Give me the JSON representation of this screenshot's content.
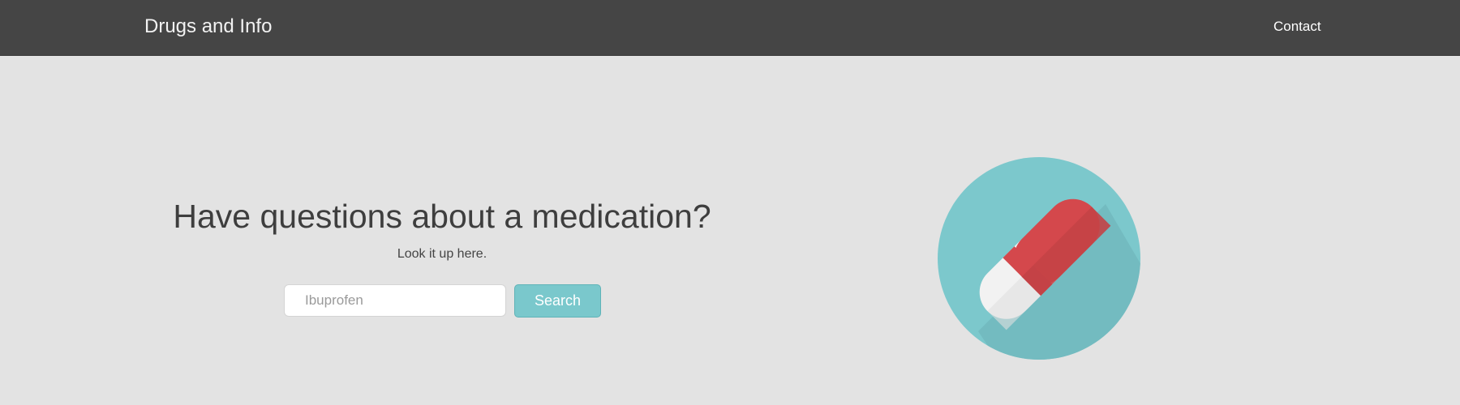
{
  "navbar": {
    "brand": "Drugs and Info",
    "links": [
      {
        "label": "Contact"
      }
    ]
  },
  "hero": {
    "headline": "Have questions about a medication?",
    "subtext": "Look it up here.",
    "search": {
      "placeholder": "Ibuprofen",
      "value": "",
      "button_label": "Search"
    },
    "illustration": {
      "icon": "pill-capsule-icon",
      "circle_color": "#7cc8cc",
      "capsule_red": "#d4484c",
      "capsule_white": "#f2f2f2"
    }
  },
  "colors": {
    "navbar_bg": "#454545",
    "page_bg": "#e3e3e3",
    "accent": "#7ac8cc"
  }
}
